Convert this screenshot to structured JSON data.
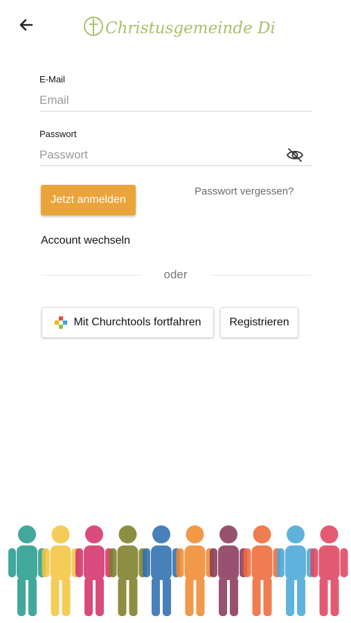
{
  "header": {
    "logo_text": "Christusgemeinde Diespeck",
    "back_icon": "arrow-left-icon"
  },
  "form": {
    "email_label": "E-Mail",
    "email_placeholder": "Email",
    "password_label": "Passwort",
    "password_placeholder": "Passwort",
    "password_toggle_icon": "eye-off-icon",
    "login_label": "Jetzt anmelden",
    "forgot_label": "Passwort vergessen?",
    "switch_account_label": "Account wechseln"
  },
  "divider": {
    "label": "oder"
  },
  "sso": {
    "churchtools_label": "Mit Churchtools fortfahren",
    "churchtools_icon": "churchtools-cross-icon",
    "register_label": "Registrieren"
  },
  "colors": {
    "accent": "#eba43a",
    "logo": "#a8c06a",
    "people": [
      "#2a9d8f",
      "#f4c542",
      "#d6336c",
      "#7f7f2a",
      "#2f6fb0",
      "#f08a30",
      "#8a3b5c",
      "#ee6a3a",
      "#4aa8d8",
      "#e0455f"
    ]
  }
}
